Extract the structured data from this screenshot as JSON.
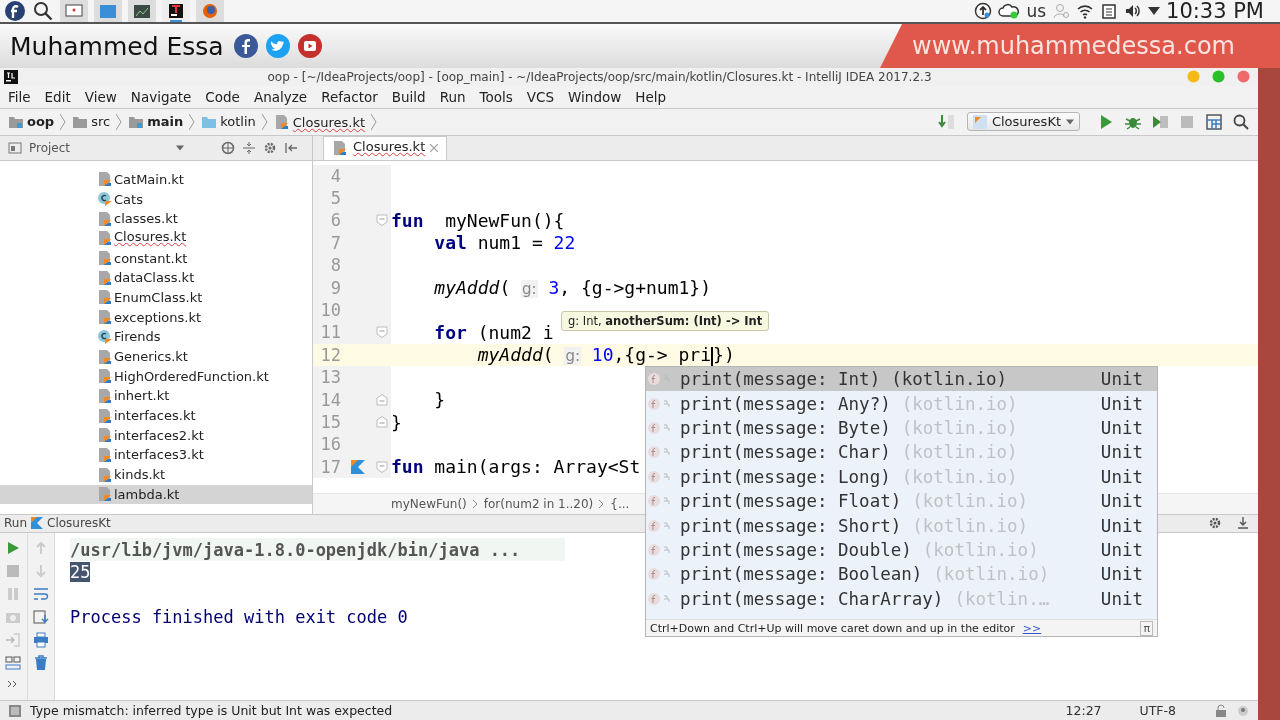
{
  "desktop_bar": {
    "keyboard_layout": "us",
    "clock": "10:33 PM"
  },
  "banner": {
    "name": "Muhammed Essa",
    "website": "www.muhammedessa.com"
  },
  "window": {
    "title": "oop - [~/IdeaProjects/oop] - [oop_main] - ~/IdeaProjects/oop/src/main/kotlin/Closures.kt - IntelliJ IDEA 2017.2.3"
  },
  "menu": [
    "File",
    "Edit",
    "View",
    "Navigate",
    "Code",
    "Analyze",
    "Refactor",
    "Build",
    "Run",
    "Tools",
    "VCS",
    "Window",
    "Help"
  ],
  "navigation": [
    {
      "label": "oop",
      "bold": true,
      "kind": "module",
      "error": false
    },
    {
      "label": "src",
      "bold": false,
      "kind": "folder",
      "error": false
    },
    {
      "label": "main",
      "bold": true,
      "kind": "module",
      "error": false
    },
    {
      "label": "kotlin",
      "bold": false,
      "kind": "source",
      "error": false
    },
    {
      "label": "Closures.kt",
      "bold": false,
      "kind": "file",
      "error": true
    }
  ],
  "run_configuration": "ClosuresKt",
  "project_panel": {
    "title": "Project",
    "files": [
      {
        "label": "CatMain.kt",
        "kind": "file",
        "selected": false,
        "error": false
      },
      {
        "label": "Cats",
        "kind": "class",
        "selected": false,
        "error": false
      },
      {
        "label": "classes.kt",
        "kind": "file",
        "selected": false,
        "error": false
      },
      {
        "label": "Closures.kt",
        "kind": "file",
        "selected": false,
        "error": true
      },
      {
        "label": "constant.kt",
        "kind": "file",
        "selected": false,
        "error": false
      },
      {
        "label": "dataClass.kt",
        "kind": "file",
        "selected": false,
        "error": false
      },
      {
        "label": "EnumClass.kt",
        "kind": "file",
        "selected": false,
        "error": false
      },
      {
        "label": "exceptions.kt",
        "kind": "file",
        "selected": false,
        "error": false
      },
      {
        "label": "Firends",
        "kind": "class",
        "selected": false,
        "error": false
      },
      {
        "label": "Generics.kt",
        "kind": "file",
        "selected": false,
        "error": false
      },
      {
        "label": "HighOrderedFunction.kt",
        "kind": "file",
        "selected": false,
        "error": false
      },
      {
        "label": "inhert.kt",
        "kind": "file",
        "selected": false,
        "error": false
      },
      {
        "label": "interfaces.kt",
        "kind": "file",
        "selected": false,
        "error": false
      },
      {
        "label": "interfaces2.kt",
        "kind": "file",
        "selected": false,
        "error": false
      },
      {
        "label": "interfaces3.kt",
        "kind": "file",
        "selected": false,
        "error": false
      },
      {
        "label": "kinds.kt",
        "kind": "file",
        "selected": false,
        "error": false
      },
      {
        "label": "lambda.kt",
        "kind": "file",
        "selected": true,
        "error": false
      }
    ]
  },
  "editor_tabs": [
    {
      "label": "Closures.kt",
      "selected": true,
      "error": true
    }
  ],
  "editor": {
    "lines": [
      {
        "number": "4",
        "current": false,
        "kind": "code"
      },
      {
        "number": "5",
        "current": false,
        "kind": "code"
      },
      {
        "number": "6",
        "current": false,
        "kind": "fold-start",
        "tokens": [
          {
            "kind": "kw",
            "text": "fun"
          },
          {
            "kind": "text",
            "text": "  myNewFun(){"
          }
        ]
      },
      {
        "number": "7",
        "current": false,
        "kind": "code",
        "tokens": [
          {
            "kind": "kw",
            "text": "    val"
          },
          {
            "kind": "text",
            "text": " num1 = "
          },
          {
            "kind": "num",
            "text": "22"
          }
        ]
      },
      {
        "number": "8",
        "current": false,
        "kind": "code"
      },
      {
        "number": "9",
        "current": false,
        "kind": "code",
        "tokens": [
          {
            "kind": "call",
            "text": "    myAddd"
          },
          {
            "kind": "text",
            "text": "( "
          },
          {
            "kind": "hint",
            "text": "g:"
          },
          {
            "kind": "num",
            "text": " 3"
          },
          {
            "kind": "text",
            "text": ", {g->g+num1})"
          }
        ]
      },
      {
        "number": "10",
        "current": false,
        "kind": "code"
      },
      {
        "number": "11",
        "current": false,
        "kind": "fold-start",
        "tokens": [
          {
            "kind": "kw",
            "text": "    for"
          },
          {
            "kind": "text",
            "text": " (num2 i"
          }
        ]
      },
      {
        "number": "12",
        "current": true,
        "kind": "code",
        "tokens": [
          {
            "kind": "call",
            "text": "        myAddd"
          },
          {
            "kind": "text",
            "text": "( "
          },
          {
            "kind": "hint",
            "text": "g:"
          },
          {
            "kind": "num",
            "text": " 10"
          },
          {
            "kind": "text",
            "text": ",{g-> pri"
          },
          {
            "kind": "caret"
          },
          {
            "kind": "text",
            "text": "})"
          }
        ]
      },
      {
        "number": "13",
        "current": false,
        "kind": "code"
      },
      {
        "number": "14",
        "current": false,
        "kind": "fold-end",
        "tokens": [
          {
            "kind": "text",
            "text": "    }"
          }
        ]
      },
      {
        "number": "15",
        "current": false,
        "kind": "fold-end",
        "tokens": [
          {
            "kind": "text",
            "text": "}"
          }
        ]
      },
      {
        "number": "16",
        "current": false,
        "kind": "code"
      },
      {
        "number": "17",
        "current": false,
        "kind": "fold-start",
        "run": true,
        "tokens": [
          {
            "kind": "kw",
            "text": "fun"
          },
          {
            "kind": "text",
            "text": " main(args: Array<St"
          }
        ]
      }
    ],
    "breadcrumbs": [
      "myNewFun()",
      "for(num2 in 1..20)",
      "{..."
    ]
  },
  "parameter_hint": "g: Int, **anotherSum: (Int) -> Int**",
  "completion": {
    "items": [
      {
        "signature": "print(message: Int)",
        "package": "(kotlin.io)",
        "type": "Unit",
        "selected": true
      },
      {
        "signature": "print(message: Any?)",
        "package": "(kotlin.io)",
        "type": "Unit",
        "selected": false
      },
      {
        "signature": "print(message: Byte)",
        "package": "(kotlin.io)",
        "type": "Unit",
        "selected": false
      },
      {
        "signature": "print(message: Char)",
        "package": "(kotlin.io)",
        "type": "Unit",
        "selected": false
      },
      {
        "signature": "print(message: Long)",
        "package": "(kotlin.io)",
        "type": "Unit",
        "selected": false
      },
      {
        "signature": "print(message: Float)",
        "package": "(kotlin.io)",
        "type": "Unit",
        "selected": false
      },
      {
        "signature": "print(message: Short)",
        "package": "(kotlin.io)",
        "type": "Unit",
        "selected": false
      },
      {
        "signature": "print(message: Double)",
        "package": "(kotlin.io)",
        "type": "Unit",
        "selected": false
      },
      {
        "signature": "print(message: Boolean)",
        "package": "(kotlin.io)",
        "type": "Unit",
        "selected": false
      },
      {
        "signature": "print(message: CharArray)",
        "package": "(kotlin.…",
        "type": "Unit",
        "selected": false
      }
    ],
    "footer": "Ctrl+Down and Ctrl+Up will move caret down and up in the editor",
    "footer_link": ">>",
    "footer_symbol": "π"
  },
  "run_panel": {
    "title": "Run",
    "configuration": "ClosuresKt",
    "console": [
      {
        "kind": "command",
        "text": "/usr/lib/jvm/java-1.8.0-openjdk/bin/java ...",
        "selected": false
      },
      {
        "kind": "output",
        "text": "25",
        "selected": true
      },
      {
        "kind": "blank"
      },
      {
        "kind": "output",
        "text": "Process finished with exit code 0",
        "selected": false
      }
    ]
  },
  "status_bar": {
    "message": "Type mismatch: inferred type is Unit but Int was expected",
    "position": "12:27",
    "encoding": "UTF-8"
  }
}
